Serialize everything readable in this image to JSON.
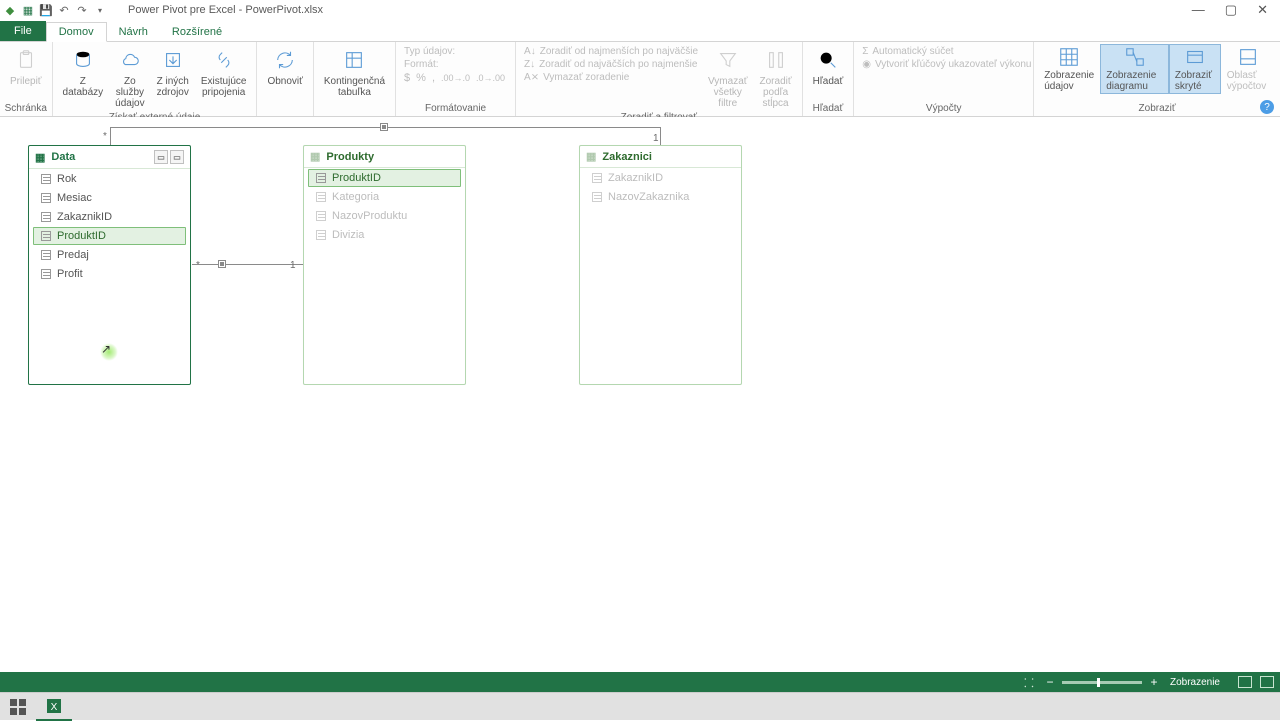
{
  "titlebar": {
    "title": "Power Pivot pre Excel - PowerPivot.xlsx"
  },
  "tabs": {
    "file": "File",
    "domov": "Domov",
    "navrh": "Návrh",
    "rozsirene": "Rozšírené"
  },
  "ribbon": {
    "schranka": {
      "label": "Schránka",
      "prilepit": "Prilepiť"
    },
    "ziskat": {
      "label": "Získať externé údaje",
      "zdatabazy": "Z\ndatabázy",
      "zosluzby": "Zo služby\núdajov",
      "zinych": "Z iných\nzdrojov",
      "existujuce": "Existujúce\npripojenia"
    },
    "obnovit": {
      "label": "Obnoviť"
    },
    "kontingencna": {
      "label": "Kontingenčná\ntabuľka"
    },
    "formatovanie": {
      "label": "Formátovanie",
      "typudajov": "Typ údajov:",
      "format": "Formát:"
    },
    "zoradit": {
      "label": "Zoradiť a filtrovať",
      "asc": "Zoradiť od najmenších po najväčšie",
      "desc": "Zoradiť od najväčších po najmenšie",
      "clear": "Vymazať zoradenie",
      "vymazat_filtre": "Vymazať\nvšetky filtre",
      "zoradit_stlpca": "Zoradiť podľa\nstĺpca"
    },
    "hladat": {
      "label": "Hľadať",
      "btn": "Hľadať"
    },
    "vypocty": {
      "label": "Výpočty",
      "autosucet": "Automatický súčet",
      "kpi": "Vytvoriť kľúčový ukazovateľ výkonu"
    },
    "zobrazit": {
      "label": "Zobraziť",
      "udajov": "Zobrazenie\núdajov",
      "diagramu": "Zobrazenie\ndiagramu",
      "skryte": "Zobraziť\nskryté",
      "oblast": "Oblasť\nvýpočtov"
    }
  },
  "diagram": {
    "tables": {
      "data": {
        "title": "Data",
        "fields": [
          "Rok",
          "Mesiac",
          "ZakaznikID",
          "ProduktID",
          "Predaj",
          "Profit"
        ]
      },
      "produkty": {
        "title": "Produkty",
        "fields": [
          "ProduktID",
          "Kategoria",
          "NazovProduktu",
          "Divizia"
        ]
      },
      "zakaznici": {
        "title": "Zakaznici",
        "fields": [
          "ZakaznikID",
          "NazovZakaznika"
        ]
      }
    },
    "rel_labels": {
      "one": "1",
      "many": "*"
    }
  },
  "statusbar": {
    "mode": "Zobrazenie"
  }
}
